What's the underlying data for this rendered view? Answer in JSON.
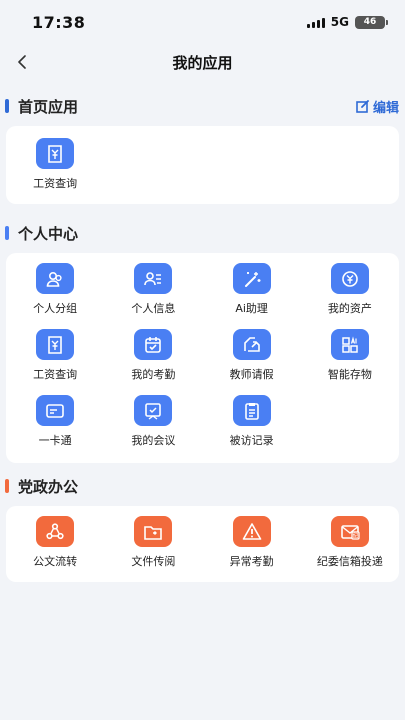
{
  "status": {
    "time": "17:38",
    "network": "5G",
    "battery": "46"
  },
  "nav": {
    "title": "我的应用"
  },
  "colors": {
    "blue": "#4a7ff3",
    "orange": "#f26a3d",
    "edit": "#2f6ad6"
  },
  "home": {
    "title": "首页应用",
    "edit_label": "编辑",
    "apps": [
      {
        "label": "工资查询",
        "icon": "salary-icon"
      }
    ]
  },
  "personal": {
    "title": "个人中心",
    "apps": [
      {
        "label": "个人分组",
        "icon": "group-icon"
      },
      {
        "label": "个人信息",
        "icon": "profile-icon"
      },
      {
        "label": "Ai助理",
        "icon": "ai-wand-icon"
      },
      {
        "label": "我的资产",
        "icon": "asset-icon"
      },
      {
        "label": "工资查询",
        "icon": "salary-icon"
      },
      {
        "label": "我的考勤",
        "icon": "calendar-icon"
      },
      {
        "label": "教师请假",
        "icon": "leave-icon"
      },
      {
        "label": "智能存物",
        "icon": "storage-icon"
      },
      {
        "label": "一卡通",
        "icon": "card-icon"
      },
      {
        "label": "我的会议",
        "icon": "meeting-icon"
      },
      {
        "label": "被访记录",
        "icon": "record-icon"
      }
    ]
  },
  "party": {
    "title": "党政办公",
    "apps": [
      {
        "label": "公文流转",
        "icon": "workflow-icon"
      },
      {
        "label": "文件传阅",
        "icon": "folder-icon"
      },
      {
        "label": "异常考勤",
        "icon": "warning-icon"
      },
      {
        "label": "纪委信箱投递",
        "icon": "mailbox-icon"
      }
    ]
  }
}
